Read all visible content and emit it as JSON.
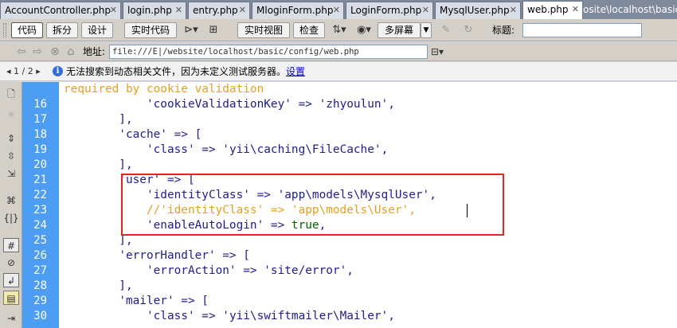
{
  "tabs": [
    {
      "label": "AccountController.php"
    },
    {
      "label": "login.php"
    },
    {
      "label": "entry.php"
    },
    {
      "label": "MloginForm.php"
    },
    {
      "label": "LoginForm.php"
    },
    {
      "label": "MysqlUser.php"
    },
    {
      "label": "web.php"
    }
  ],
  "path_text": "osite\\localhost\\basic\\c",
  "toolbar": {
    "code_label": "代码",
    "split_label": "拆分",
    "design_label": "设计",
    "live_code_label": "实时代码",
    "live_view_label": "实时视图",
    "inspect_label": "检查",
    "multiscreen_label": "多屏幕",
    "title_label": "标题:",
    "title_value": ""
  },
  "address": {
    "label": "地址:",
    "value": "file:///E|/website/localhost/basic/config/web.php"
  },
  "infobar": {
    "page_nav": "◂ 1 / 2 ▸",
    "message": "无法搜索到动态相关文件，因为未定义测试服务器。",
    "link": "设置"
  },
  "code": {
    "partial_top": "required by cookie validation",
    "lines": [
      {
        "n": "16",
        "segs": [
          {
            "t": "            ",
            "c": ""
          },
          {
            "t": "'cookieValidationKey'",
            "c": "str"
          },
          {
            "t": " => ",
            "c": "br"
          },
          {
            "t": "'zhyoulun'",
            "c": "str"
          },
          {
            "t": ",",
            "c": "br"
          }
        ]
      },
      {
        "n": "17",
        "segs": [
          {
            "t": "        ],",
            "c": "br"
          }
        ]
      },
      {
        "n": "18",
        "segs": [
          {
            "t": "        ",
            "c": ""
          },
          {
            "t": "'cache'",
            "c": "str"
          },
          {
            "t": " => [",
            "c": "br"
          }
        ]
      },
      {
        "n": "19",
        "segs": [
          {
            "t": "            ",
            "c": ""
          },
          {
            "t": "'class'",
            "c": "str"
          },
          {
            "t": " => ",
            "c": "br"
          },
          {
            "t": "'yii\\caching\\FileCache'",
            "c": "str"
          },
          {
            "t": ",",
            "c": "br"
          }
        ]
      },
      {
        "n": "20",
        "segs": [
          {
            "t": "        ],",
            "c": "br"
          }
        ]
      },
      {
        "n": "21",
        "segs": [
          {
            "t": "        ",
            "c": ""
          },
          {
            "t": "'user'",
            "c": "str"
          },
          {
            "t": " => [",
            "c": "br"
          }
        ]
      },
      {
        "n": "22",
        "segs": [
          {
            "t": "            ",
            "c": ""
          },
          {
            "t": "'identityClass'",
            "c": "str"
          },
          {
            "t": " => ",
            "c": "br"
          },
          {
            "t": "'app\\models\\MysqlUser'",
            "c": "str"
          },
          {
            "t": ",",
            "c": "br"
          }
        ]
      },
      {
        "n": "23",
        "segs": [
          {
            "t": "            //'identityClass' => 'app\\models\\User',",
            "c": "cmt"
          }
        ]
      },
      {
        "n": "24",
        "segs": [
          {
            "t": "            ",
            "c": ""
          },
          {
            "t": "'enableAutoLogin'",
            "c": "str"
          },
          {
            "t": " => ",
            "c": "br"
          },
          {
            "t": "true",
            "c": "kw"
          },
          {
            "t": ",",
            "c": "br"
          }
        ]
      },
      {
        "n": "25",
        "segs": [
          {
            "t": "        ],",
            "c": "br"
          }
        ]
      },
      {
        "n": "26",
        "segs": [
          {
            "t": "        ",
            "c": ""
          },
          {
            "t": "'errorHandler'",
            "c": "str"
          },
          {
            "t": " => [",
            "c": "br"
          }
        ]
      },
      {
        "n": "27",
        "segs": [
          {
            "t": "            ",
            "c": ""
          },
          {
            "t": "'errorAction'",
            "c": "str"
          },
          {
            "t": " => ",
            "c": "br"
          },
          {
            "t": "'site/error'",
            "c": "str"
          },
          {
            "t": ",",
            "c": "br"
          }
        ]
      },
      {
        "n": "28",
        "segs": [
          {
            "t": "        ],",
            "c": "br"
          }
        ]
      },
      {
        "n": "29",
        "segs": [
          {
            "t": "        ",
            "c": ""
          },
          {
            "t": "'mailer'",
            "c": "str"
          },
          {
            "t": " => [",
            "c": "br"
          }
        ]
      },
      {
        "n": "30",
        "segs": [
          {
            "t": "            ",
            "c": ""
          },
          {
            "t": "'class'",
            "c": "str"
          },
          {
            "t": " => ",
            "c": "br"
          },
          {
            "t": "'yii\\swiftmailer\\Mailer'",
            "c": "str"
          },
          {
            "t": ",",
            "c": "br"
          }
        ]
      }
    ]
  },
  "colors": {
    "gutter": "#4d9df2",
    "comment": "#e7a01d",
    "string": "#1d1d8f",
    "keyword": "#006400",
    "highlight_box": "#e2271f"
  }
}
